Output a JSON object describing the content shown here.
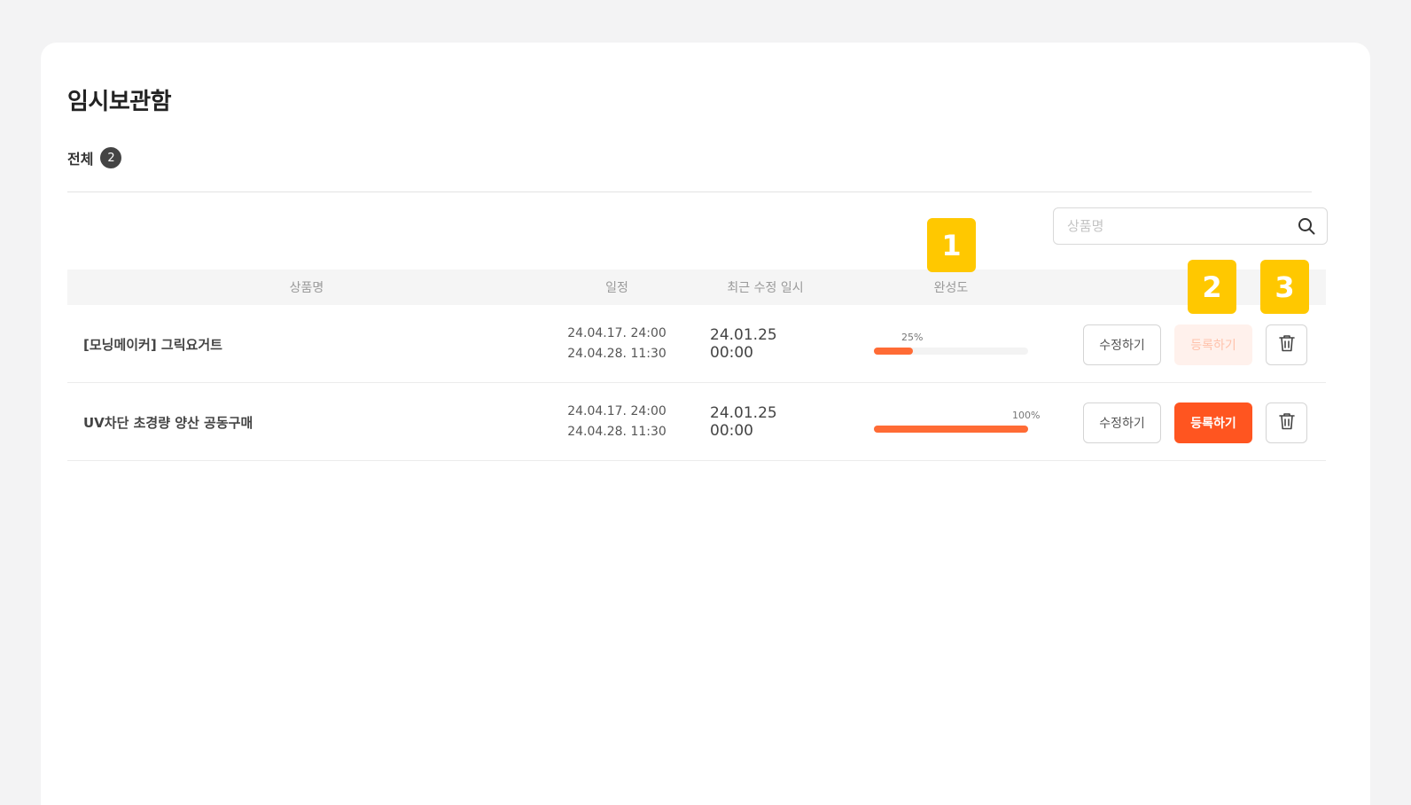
{
  "page": {
    "title": "임시보관함",
    "filter_label": "전체",
    "filter_count": "2"
  },
  "search": {
    "placeholder": "상품명",
    "value": ""
  },
  "table": {
    "headers": {
      "name": "상품명",
      "schedule": "일정",
      "modified": "최근 수정 일시",
      "completion": "완성도"
    },
    "rows": [
      {
        "name": "[모닝메이커] 그릭요거트",
        "schedule_start": "24.04.17. 24:00",
        "schedule_end": "24.04.28. 11:30",
        "modified": "24.01.25 00:00",
        "completion_label": "25%",
        "completion": 0.25,
        "edit_label": "수정하기",
        "register_label": "등록하기",
        "register_enabled": false
      },
      {
        "name": "UV차단 초경량 양산 공동구매",
        "schedule_start": "24.04.17. 24:00",
        "schedule_end": "24.04.28. 11:30",
        "modified": "24.01.25 00:00",
        "completion_label": "100%",
        "completion": 1.0,
        "edit_label": "수정하기",
        "register_label": "등록하기",
        "register_enabled": true
      }
    ]
  },
  "markers": [
    "1",
    "2",
    "3"
  ],
  "colors": {
    "accent": "#ff5520",
    "progress": "#ff6b35",
    "marker": "#ffc800",
    "register_disabled_bg": "#fff1ec"
  }
}
